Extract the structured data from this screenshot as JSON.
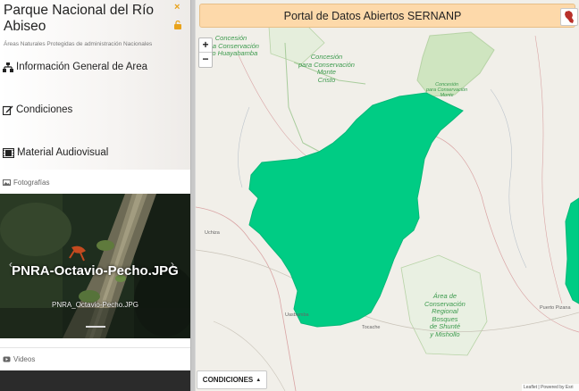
{
  "sidebar": {
    "park_title": "Parque Nacional del Río Abiseo",
    "subtitle": "Áreas Naturales Protegidas de administración Nacionales",
    "close_glyph": "×",
    "menu": [
      {
        "label": "Información General de Area",
        "icon": "sitemap-icon"
      },
      {
        "label": "Condiciones",
        "icon": "edit-icon"
      },
      {
        "label": "Material Audiovisual",
        "icon": "film-icon"
      }
    ],
    "photos_label": "Fotografías",
    "videos_label": "Videos",
    "carousel": {
      "caption": "PNRA-Octavio-Pecho.JPG",
      "filename": "PNRA_Octavio-Pecho.JPG",
      "prev_glyph": "‹",
      "next_glyph": "›"
    }
  },
  "map": {
    "portal_title": "Portal de Datos Abiertos SERNANP",
    "zoom_in": "+",
    "zoom_out": "−",
    "conditions_button": "CONDICIONES",
    "attribution": "Leaflet | Powered by Esri",
    "labels": {
      "huayabamba": "Concesión\npara Conservación\nAlto Huayabamba",
      "monte_cristo": "Concesión\npara Conservación\nMonte\nCristo",
      "conservacion_ne": "Concesión\npara Conservación\nMonte",
      "bosques": "Área de\nConservación\nRegional\nBosques\nde Shunté\ny Mishollo"
    },
    "towns": {
      "uchiza": "Uchiza",
      "puerto_pizana": "Puerto Pizana",
      "lasbambas": "Uasbamba",
      "tocache": "Tocache"
    },
    "colors": {
      "park_fill": "#00cc84",
      "reserve_fill": "#cfe5c0",
      "portal_bar": "#fdd9aa"
    }
  }
}
